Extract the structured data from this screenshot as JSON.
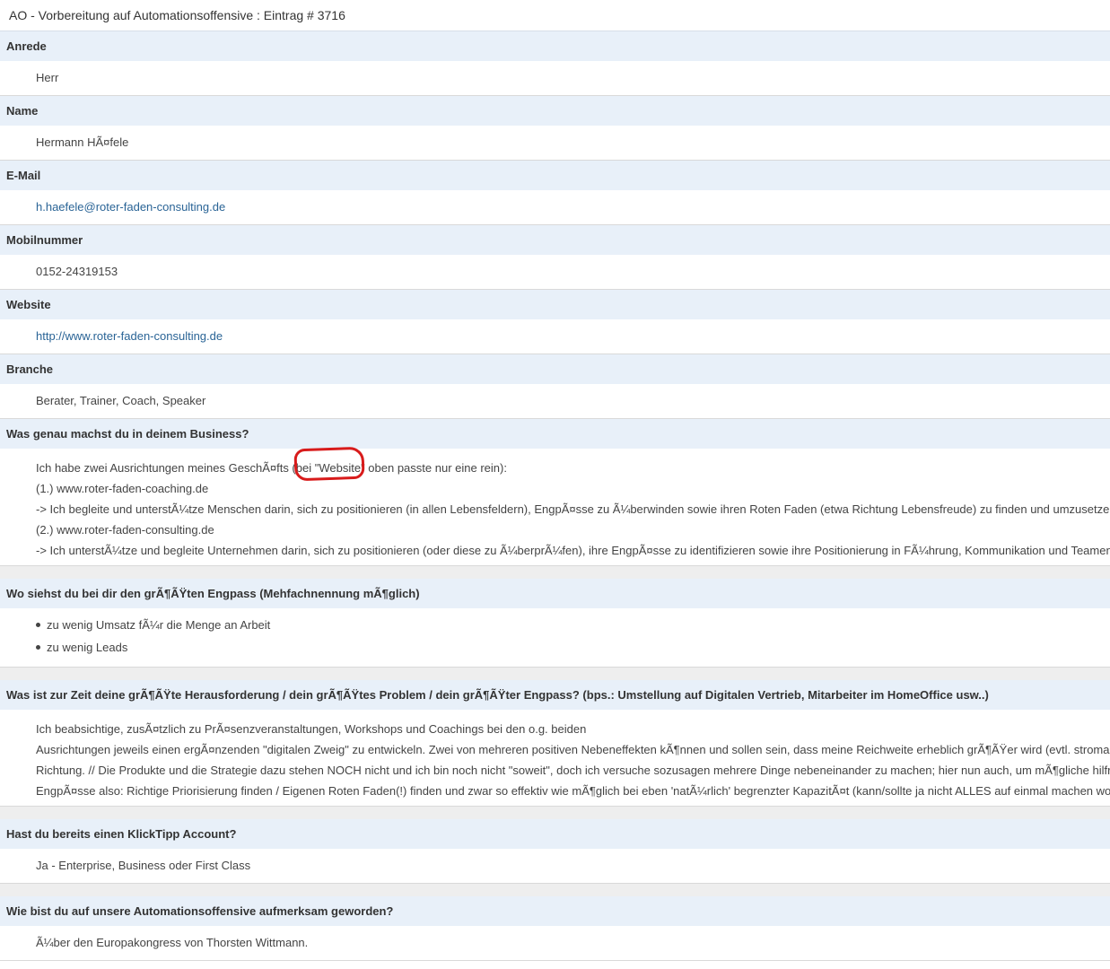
{
  "entry": {
    "title": "AO - Vorbereitung auf Automationsoffensive : Eintrag # 3716"
  },
  "fields": {
    "anrede": {
      "label": "Anrede",
      "value": "Herr"
    },
    "name": {
      "label": "Name",
      "value": "Hermann HÃ¤fele"
    },
    "email": {
      "label": "E-Mail",
      "value": "h.haefele@roter-faden-consulting.de"
    },
    "mobile": {
      "label": "Mobilnummer",
      "value": "0152-24319153"
    },
    "website": {
      "label": "Website",
      "value": "http://www.roter-faden-consulting.de"
    },
    "branche": {
      "label": "Branche",
      "value": "Berater, Trainer, Coach, Speaker"
    },
    "business": {
      "label": "Was genau machst du in deinem Business?",
      "lines": [
        "Ich habe zwei Ausrichtungen meines GeschÃ¤fts (bei \"Website\" oben passte nur eine rein):",
        "(1.) www.roter-faden-coaching.de",
        "-> Ich begleite und unterstÃ¼tze Menschen darin, sich zu positionieren (in allen Lebensfeldern), EngpÃ¤sse zu Ã¼berwinden sowie ihren Roten Faden (etwa Richtung Lebensfreude) zu finden und umzusetzen.",
        "(2.) www.roter-faden-consulting.de",
        "-> Ich unterstÃ¼tze und begleite Unternehmen darin, sich zu positionieren (oder diese zu Ã¼berprÃ¼fen), ihre EngpÃ¤sse zu identifizieren sowie ihre Positionierung in FÃ¼hrung, Kommunikation und Teamentwicklung"
      ]
    },
    "engpass": {
      "label": "Wo siehst du bei dir den grÃ¶ÃŸten Engpass (Mehfachnennung mÃ¶glich)",
      "items": [
        "zu wenig Umsatz fÃ¼r die Menge an Arbeit",
        "zu wenig Leads"
      ]
    },
    "herausforderung": {
      "label": "Was ist zur Zeit deine grÃ¶ÃŸte Herausforderung / dein grÃ¶ÃŸtes Problem / dein grÃ¶ÃŸter Engpass? (bps.: Umstellung auf Digitalen Vertrieb, Mitarbeiter im HomeOffice usw..)",
      "lines": [
        "Ich beabsichtige, zusÃ¤tzlich zu PrÃ¤senzveranstaltungen, Workshops und Coachings bei den o.g. beiden",
        "Ausrichtungen jeweils einen ergÃ¤nzenden \"digitalen Zweig\" zu entwickeln. Zwei von mehreren positiven Nebeneffekten kÃ¶nnen und sollen sein, dass meine Reichweite erheblich grÃ¶ÃŸer wird (evtl. stromabwärts",
        "Richtung. // Die Produkte und die Strategie dazu stehen NOCH nicht und ich bin noch nicht \"soweit\", doch ich versuche sozusagen mehrere Dinge nebeneinander zu machen; hier nun auch, um mÃ¶gliche hilfreiche",
        "EngpÃ¤sse also: Richtige Priorisierung finden / Eigenen Roten Faden(!) finden und zwar so effektiv wie mÃ¶glich bei eben 'natÃ¼rlich' begrenzter KapazitÃ¤t (kann/sollte ja nicht ALLES auf einmal machen wollen"
      ]
    },
    "klicktipp": {
      "label": "Hast du bereits einen KlickTipp Account?",
      "value": "Ja - Enterprise, Business oder First Class"
    },
    "aufmerksam": {
      "label": "Wie bist du auf unsere Automationsoffensive aufmerksam geworden?",
      "value": "Ã¼ber den Europakongress von Thorsten Wittmann."
    }
  },
  "colors": {
    "label_background": "#e8f0f9",
    "link": "#2a6496",
    "annotation": "#d81b1b"
  }
}
